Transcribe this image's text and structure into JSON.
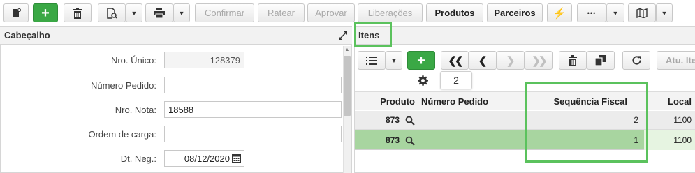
{
  "toolbar": {
    "confirmar": "Confirmar",
    "ratear": "Ratear",
    "aprovar": "Aprovar",
    "liberacoes": "Liberações",
    "produtos": "Produtos",
    "parceiros": "Parceiros",
    "more": "•••"
  },
  "header_panel": {
    "title": "Cabeçalho",
    "fields": {
      "nro_unico": {
        "label": "Nro. Único:",
        "value": "128379"
      },
      "numero_pedido": {
        "label": "Número Pedido:",
        "value": ""
      },
      "nro_nota": {
        "label": "Nro. Nota:",
        "value": "18588"
      },
      "ordem_carga": {
        "label": "Ordem de carga:",
        "value": ""
      },
      "dt_neg": {
        "label": "Dt. Neg.:",
        "value": "08/12/2020"
      }
    }
  },
  "items_panel": {
    "title": "Itens",
    "atu_label": "Atu. Ite",
    "page_size": "2",
    "columns": [
      "Produto",
      "Número Pedido",
      "Sequência Fiscal",
      "Local"
    ],
    "rows": [
      {
        "produto": "873",
        "numero_pedido": "",
        "sequencia_fiscal": "2",
        "local": "1100"
      },
      {
        "produto": "873",
        "numero_pedido": "",
        "sequencia_fiscal": "1",
        "local": "1100"
      }
    ]
  },
  "colors": {
    "accent_green": "#3aa845",
    "highlight": "#5bc25d",
    "selected_row": "#a8d5a0"
  }
}
